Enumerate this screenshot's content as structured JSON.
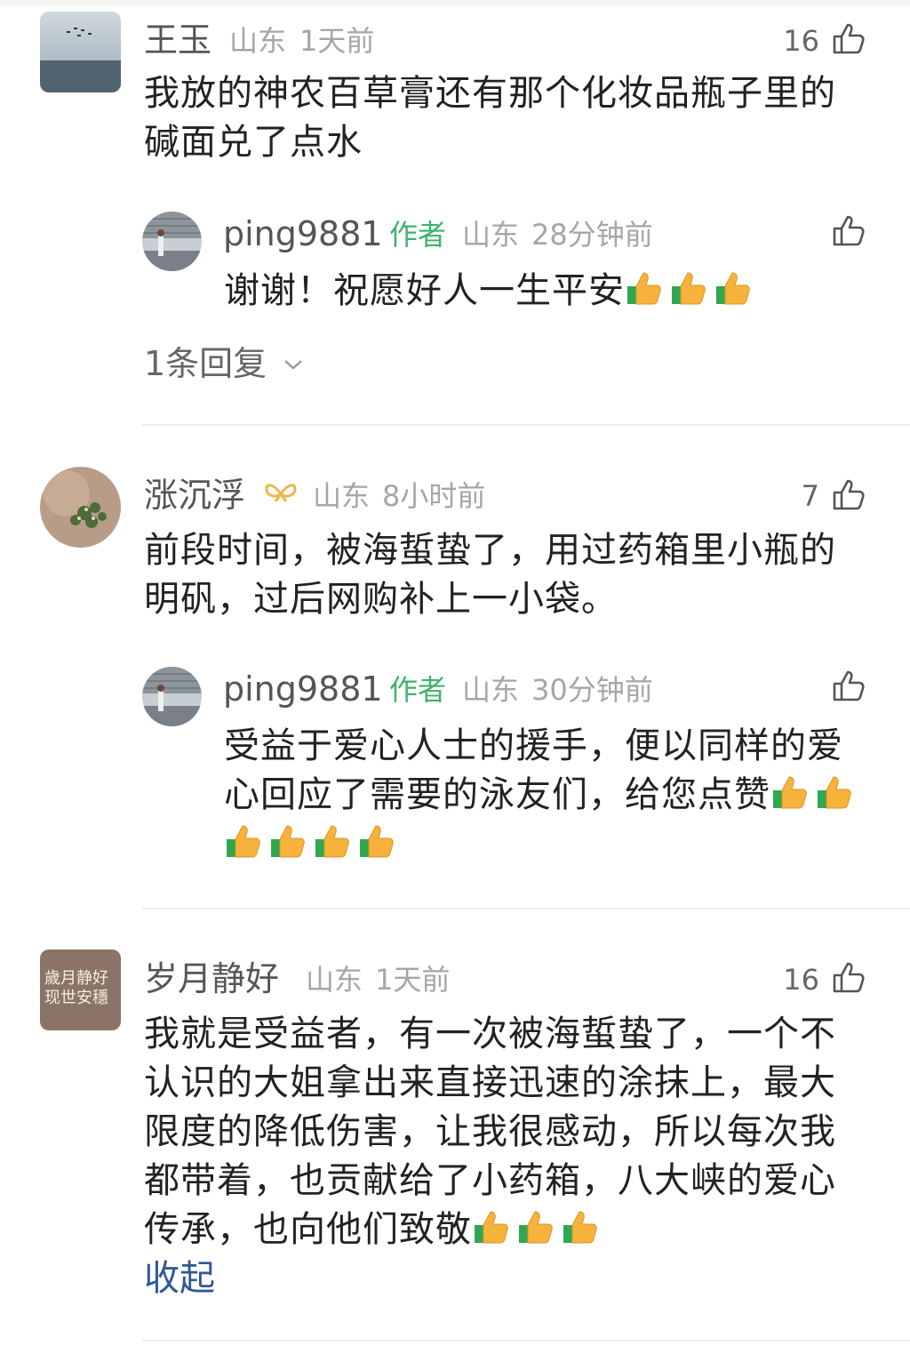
{
  "colors": {
    "text_main": "#222222",
    "text_name": "#555555",
    "text_meta": "#a6a6a6",
    "author_green": "#3db36a",
    "link_blue": "#2f5896",
    "divider": "#eeeeee",
    "thumbs_yellow": "#f6b23a",
    "thumbs_green": "#2fa84f"
  },
  "comments": [
    {
      "user": "王玉",
      "location": "山东",
      "time": "1天前",
      "likes": "16",
      "body_lines": [
        "我放的神农百草膏还有那个化妆品瓶子里的",
        "碱面兑了点水"
      ],
      "reply": {
        "user": "ping9881",
        "tag": "作者",
        "location": "山东",
        "time": "28分钟前",
        "body": "谢谢！祝愿好人一生平安",
        "emoji_count": 3,
        "emoji": "thumbs-up-icon"
      },
      "more_replies": "1条回复"
    },
    {
      "user": "涨沉浮",
      "badge": "ribbon-badge-icon",
      "location": "山东",
      "time": "8小时前",
      "likes": "7",
      "body_lines": [
        "前段时间，被海蜇蛰了，用过药箱里小瓶的",
        "明矾，过后网购补上一小袋。"
      ],
      "reply": {
        "user": "ping9881",
        "tag": "作者",
        "location": "山东",
        "time": "30分钟前",
        "body_lines": [
          "受益于爱心人士的援手，便以同样的爱",
          "心回应了需要的泳友们，给您点赞"
        ],
        "emoji_line1_count": 2,
        "emoji_line2_count": 4,
        "emoji": "thumbs-up-icon"
      }
    },
    {
      "user": "岁月静好",
      "avatar_text": [
        "歲月静好",
        "现世安穩"
      ],
      "location": "山东",
      "time": "1天前",
      "likes": "16",
      "body_lines": [
        "我就是受益者，有一次被海蜇蛰了，一个不",
        "认识的大姐拿出来直接迅速的涂抹上，最大",
        "限度的降低伤害，让我很感动，所以每次我",
        "都带着，也贡献给了小药箱，八大峡的爱心",
        "传承，也向他们致敬"
      ],
      "emoji_count": 3,
      "collapse_label": "收起"
    }
  ]
}
